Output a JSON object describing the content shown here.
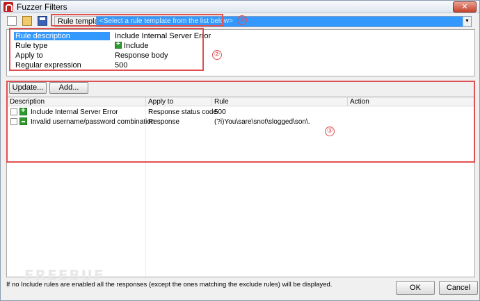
{
  "window": {
    "title": "Fuzzer Filters",
    "close_glyph": "✕"
  },
  "toolbar": {
    "icons": [
      "new-file-icon",
      "open-folder-icon",
      "save-icon"
    ],
    "template_label": "Rule template:",
    "template_value": "<Select a rule template from the list below>",
    "dropdown_glyph": "▼"
  },
  "properties": [
    {
      "name": "Rule description",
      "value": "Include Internal Server Error"
    },
    {
      "name": "Rule type",
      "value": "Include"
    },
    {
      "name": "Apply to",
      "value": "Response body"
    },
    {
      "name": "Regular expression",
      "value": "500"
    }
  ],
  "buttons": {
    "update": "Update...",
    "add": "Add...",
    "ok": "OK",
    "cancel": "Cancel"
  },
  "table": {
    "columns": [
      "Description",
      "Apply to",
      "Rule",
      "Action"
    ],
    "rows": [
      {
        "type": "include",
        "description": "Include Internal Server Error",
        "apply_to": "Response status code",
        "rule": "500",
        "action": ""
      },
      {
        "type": "exclude",
        "description": "Invalid username/password combination",
        "apply_to": "Response",
        "rule": "(?i)You\\sare\\snot\\slogged\\son\\.",
        "action": ""
      }
    ]
  },
  "annotations": [
    "①",
    "②",
    "③"
  ],
  "colors": {
    "annotation": "#e05050",
    "selection": "#3399ff",
    "include_icon": "#2f9b2f"
  },
  "status_text": "If no Include rules are enabled all the responses (except the ones matching the exclude rules) will be displayed.",
  "watermark": "FREEBUF"
}
